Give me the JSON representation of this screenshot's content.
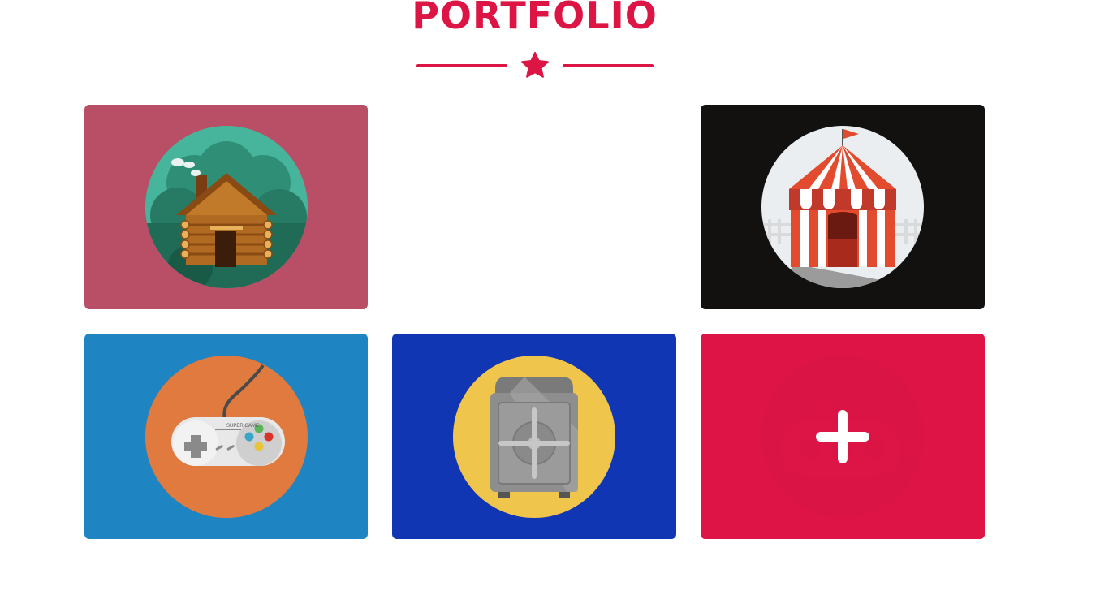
{
  "section": {
    "title": "PORTFOLIO"
  },
  "colors": {
    "accent": "#dc1545",
    "card_cabin": "#b94f66",
    "card_circus": "#13110f",
    "card_game": "#1f84c2",
    "card_safe": "#1136b4",
    "card_submarine": "#dc1545"
  },
  "portfolio_items": [
    {
      "icon": "cabin-icon",
      "hovered": false
    },
    {
      "icon": "empty",
      "hovered": false
    },
    {
      "icon": "circus-tent-icon",
      "hovered": false
    },
    {
      "icon": "game-controller-icon",
      "hovered": false,
      "controller_text": "SUPER GAME"
    },
    {
      "icon": "safe-icon",
      "hovered": false
    },
    {
      "icon": "submarine-icon",
      "hovered": true,
      "overlay_icon": "plus-icon"
    }
  ]
}
